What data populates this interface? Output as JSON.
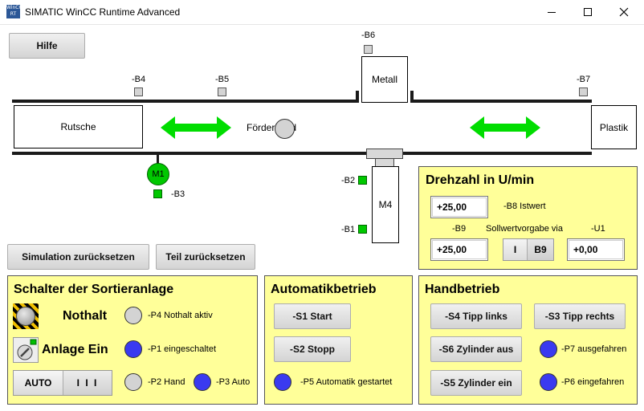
{
  "window": {
    "icon_text": "WinCC RT",
    "title": "SIMATIC WinCC Runtime Advanced"
  },
  "toolbar": {
    "help_label": "Hilfe"
  },
  "plant": {
    "sensors": {
      "b4": "-B4",
      "b5": "-B5",
      "b6": "-B6",
      "b7": "-B7",
      "b3": "-B3",
      "b2": "-B2",
      "b1": "-B1"
    },
    "stations": {
      "rutsche": "Rutsche",
      "metall": "Metall",
      "plastik": "Plastik",
      "m4": "M4"
    },
    "conveyor_label": "Förderband",
    "motor_label": "M1"
  },
  "reset": {
    "simulation_label": "Simulation zurücksetzen",
    "part_label": "Teil zurücksetzen"
  },
  "speed_panel": {
    "title": "Drehzahl in U/min",
    "actual_value": "+25,00",
    "actual_label": "-B8 Istwert",
    "b9_label": "-B9",
    "via_label": "Sollwertvorgabe via",
    "u1_label": "-U1",
    "setpoint_value": "+25,00",
    "toggle_left": "I",
    "toggle_right": "B9",
    "u1_value": "+0,00"
  },
  "switch_panel": {
    "title": "Schalter der Sortieranlage",
    "emergency_label": "Nothalt",
    "p4_label": "-P4 Nothalt aktiv",
    "power_label": "Anlage Ein",
    "p1_label": "-P1 eingeschaltet",
    "auto_label": "AUTO",
    "manual_label": "I I I",
    "p2_label": "-P2 Hand",
    "p3_label": "-P3 Auto"
  },
  "auto_panel": {
    "title": "Automatikbetrieb",
    "start_label": "-S1 Start",
    "stop_label": "-S2 Stopp",
    "p5_label": "-P5 Automatik gestartet"
  },
  "manual_panel": {
    "title": "Handbetrieb",
    "jog_left_label": "-S4 Tipp links",
    "jog_right_label": "-S3 Tipp rechts",
    "cyl_off_label": "-S6 Zylinder aus",
    "p7_label": "-P7 ausgefahren",
    "cyl_on_label": "-S5 Zylinder ein",
    "p6_label": "-P6 eingefahren"
  },
  "colors": {
    "panel_bg": "#ffff99",
    "lamp_on": "#3a3af0",
    "lamp_off": "#d3d3d3",
    "sensor_active": "#00c800",
    "arrow": "#00dd00"
  }
}
